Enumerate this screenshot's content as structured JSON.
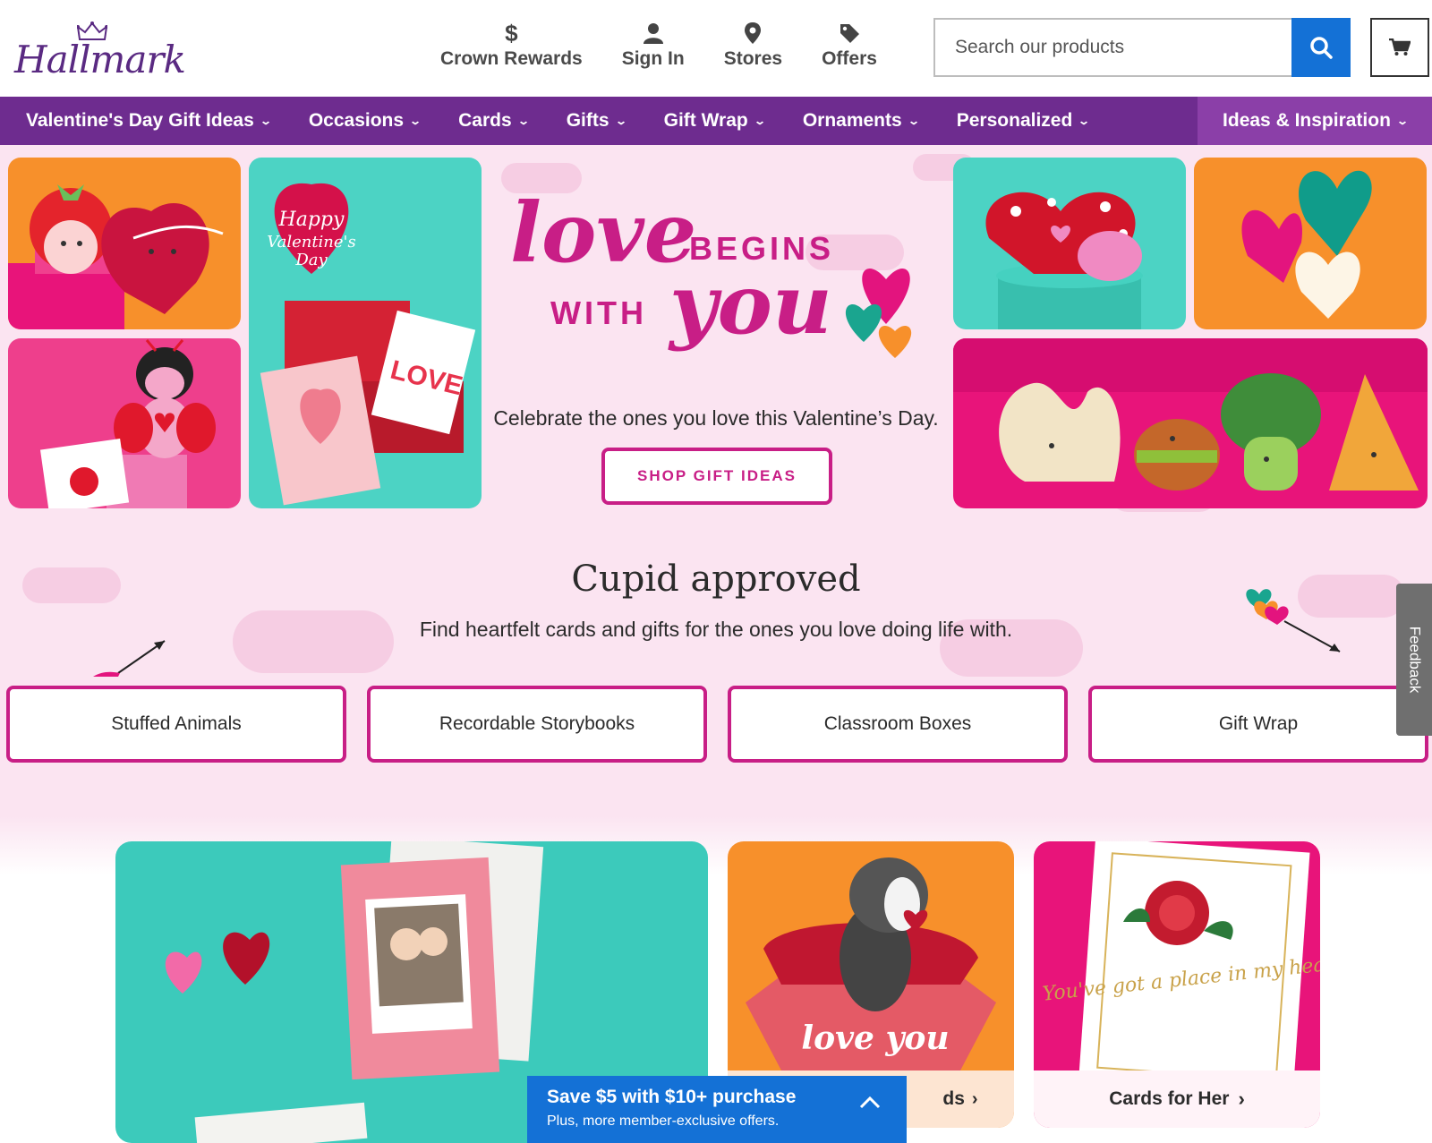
{
  "brand": {
    "name": "Hallmark"
  },
  "utility_links": [
    {
      "label": "Crown Rewards",
      "icon": "dollar-icon"
    },
    {
      "label": "Sign In",
      "icon": "user-icon"
    },
    {
      "label": "Stores",
      "icon": "map-pin-icon"
    },
    {
      "label": "Offers",
      "icon": "tag-icon"
    }
  ],
  "search": {
    "placeholder": "Search our products",
    "value": ""
  },
  "nav": {
    "items": [
      {
        "label": "Valentine's Day Gift Ideas"
      },
      {
        "label": "Occasions"
      },
      {
        "label": "Cards"
      },
      {
        "label": "Gifts"
      },
      {
        "label": "Gift Wrap"
      },
      {
        "label": "Ornaments"
      },
      {
        "label": "Personalized"
      },
      {
        "label": "Ideas & Inspiration"
      }
    ]
  },
  "hero": {
    "title_line1_big": "love",
    "title_line1_small": "BEGINS",
    "title_line2_small": "WITH",
    "title_line2_big": "you",
    "subtitle": "Celebrate the ones you love this Valentine’s Day.",
    "cta_label": "SHOP GIFT IDEAS",
    "card_text_happy": "Happy",
    "card_text_valentines": "Valentine's",
    "card_text_day": "Day",
    "card_text_love": "LOVE"
  },
  "cupid": {
    "title": "Cupid approved",
    "subtitle": "Find heartfelt cards and gifts for the ones you love doing life with.",
    "categories": [
      {
        "label": "Stuffed Animals"
      },
      {
        "label": "Recordable Storybooks"
      },
      {
        "label": "Classroom Boxes"
      },
      {
        "label": "Gift Wrap"
      }
    ]
  },
  "feedback_label": "Feedback",
  "lower_cards": {
    "middle_label_partial": "ds",
    "right_label": "Cards for Her",
    "middle_card_text": "love you",
    "right_card_text": "You've got a place in my heart"
  },
  "promo": {
    "title": "Save $5 with $10+ purchase",
    "subtitle": "Plus, more member-exclusive offers."
  },
  "colors": {
    "brand_purple": "#6e2c8f",
    "accent_pink": "#c81e86",
    "cta_blue": "#1471d6",
    "hero_bg": "#fbe4f1"
  }
}
